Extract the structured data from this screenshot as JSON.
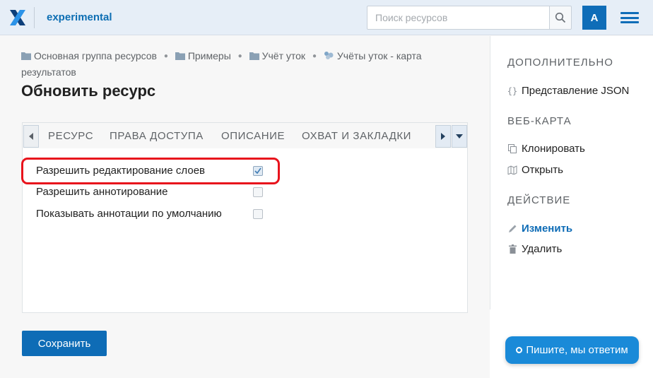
{
  "header": {
    "app_name": "experimental",
    "search_placeholder": "Поиск ресурсов",
    "avatar_letter": "A"
  },
  "breadcrumb": [
    {
      "label": "Основная группа ресурсов",
      "icon": "folder-icon"
    },
    {
      "label": "Примеры",
      "icon": "folder-icon"
    },
    {
      "label": "Учёт уток",
      "icon": "folder-icon"
    },
    {
      "label": "Учёты уток - карта результатов",
      "icon": "webmap-icon"
    }
  ],
  "page_title": "Обновить ресурс",
  "tabs": [
    {
      "label": "Ресурс"
    },
    {
      "label": "Права доступа"
    },
    {
      "label": "Описание"
    },
    {
      "label": "Охват и закладки"
    }
  ],
  "options": [
    {
      "label": "Разрешить редактирование слоев",
      "checked": true
    },
    {
      "label": "Разрешить аннотирование",
      "checked": false
    },
    {
      "label": "Показывать аннотации по умолчанию",
      "checked": false
    }
  ],
  "save_label": "Сохранить",
  "sidebar": {
    "extra_heading": "Дополнительно",
    "json_label": "Представление JSON",
    "webmap_heading": "Веб-карта",
    "clone_label": "Клонировать",
    "open_label": "Открыть",
    "action_heading": "Действие",
    "edit_label": "Изменить",
    "delete_label": "Удалить"
  },
  "chat_label": "Пишите, мы ответим",
  "colors": {
    "accent": "#0e6cb6",
    "highlight": "#e8131c",
    "chat": "#1a8ad8"
  }
}
